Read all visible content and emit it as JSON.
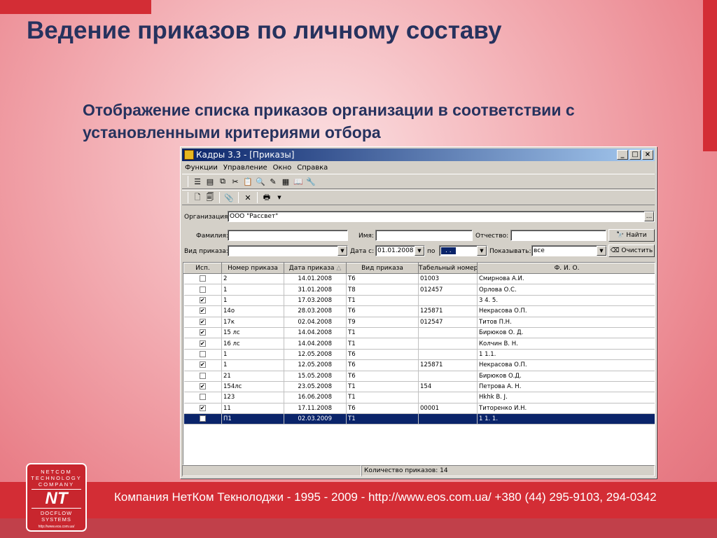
{
  "slide": {
    "title": "Ведение приказов по личному составу",
    "subtitle": "Отображение списка приказов организации в соответствии с установленными критериями отбора"
  },
  "footer": {
    "text": "Компания НетКом Текнолоджи - 1995 - 2009 - http://www.eos.com.ua/ +380 (44) 295-9103, 294-0342"
  },
  "logo": {
    "top": "NETCOM TECHNOLOGY COMPANY",
    "mark": "NT",
    "bottom": "DOCFLOW SYSTEMS",
    "url": "http://www.eos.com.ua/"
  },
  "window": {
    "title": "Кадры 3.3 - [Приказы]",
    "controls": [
      "_",
      "□",
      "×"
    ]
  },
  "menu": [
    "Функции",
    "Управление",
    "Окно",
    "Справка"
  ],
  "filters": {
    "org_label": "Организация:",
    "org_value": "ООО \"Рассвет\"",
    "org_button": "...",
    "surname_label": "Фамилия:",
    "surname_value": "",
    "name_label": "Имя:",
    "name_value": "",
    "patronymic_label": "Отчество:",
    "patronymic_value": "",
    "find_button": "Найти",
    "order_type_label": "Вид приказа:",
    "order_type_value": "",
    "date_from_label": "Дата с:",
    "date_from_value": "01.01.2008",
    "date_to_label": "по",
    "date_to_value": ". .",
    "show_label": "Показывать:",
    "show_value": "все",
    "clear_button": "Очистить"
  },
  "table": {
    "headers": [
      "Исп.",
      "Номер приказа",
      "Дата приказа",
      "Вид приказа",
      "Табельный номер",
      "Ф. И. О."
    ],
    "sort_indicator": "△",
    "rows": [
      {
        "done": false,
        "number": "2",
        "date": "14.01.2008",
        "type": "Т6",
        "tab": "01003",
        "fio": "Смирнова А.И."
      },
      {
        "done": false,
        "number": "1",
        "date": "31.01.2008",
        "type": "Т8",
        "tab": "012457",
        "fio": "Орлова О.С."
      },
      {
        "done": true,
        "number": "1",
        "date": "17.03.2008",
        "type": "Т1",
        "tab": "",
        "fio": "3 4. 5."
      },
      {
        "done": true,
        "number": "14о",
        "date": "28.03.2008",
        "type": "Т6",
        "tab": "125871",
        "fio": "Некрасова О.П."
      },
      {
        "done": true,
        "number": "17к",
        "date": "02.04.2008",
        "type": "Т9",
        "tab": "012547",
        "fio": "Титов П.Н."
      },
      {
        "done": true,
        "number": "15 лс",
        "date": "14.04.2008",
        "type": "Т1",
        "tab": "",
        "fio": "Бирюков О. Д."
      },
      {
        "done": true,
        "number": "16 лс",
        "date": "14.04.2008",
        "type": "Т1",
        "tab": "",
        "fio": "Колчин В. Н."
      },
      {
        "done": false,
        "number": "1",
        "date": "12.05.2008",
        "type": "Т6",
        "tab": "",
        "fio": "1 1.1."
      },
      {
        "done": true,
        "number": "1",
        "date": "12.05.2008",
        "type": "Т6",
        "tab": "125871",
        "fio": "Некрасова О.П."
      },
      {
        "done": false,
        "number": "21",
        "date": "15.05.2008",
        "type": "Т6",
        "tab": "",
        "fio": "Бирюков О.Д."
      },
      {
        "done": true,
        "number": "154лс",
        "date": "23.05.2008",
        "type": "Т1",
        "tab": "154",
        "fio": "Петрова А. Н."
      },
      {
        "done": false,
        "number": "123",
        "date": "16.06.2008",
        "type": "Т1",
        "tab": "",
        "fio": "Hkhk В. J."
      },
      {
        "done": true,
        "number": "11",
        "date": "17.11.2008",
        "type": "Т6",
        "tab": "00001",
        "fio": "Титоренко И.Н."
      },
      {
        "done": false,
        "number": "П1",
        "date": "02.03.2009",
        "type": "Т1",
        "tab": "",
        "fio": "1 1. 1.",
        "selected": true
      }
    ]
  },
  "status": {
    "count_text": "Количество приказов: 14"
  },
  "colors": {
    "accent_red": "#d32d35",
    "title_blue": "#26325e",
    "titlebar": "#0a246a",
    "selection": "#0a246a"
  },
  "toolbar1_icons": [
    "list-icon",
    "card-icon",
    "copy-icon",
    "scissors-icon",
    "clipboard-icon",
    "search-icon",
    "edit-icon",
    "table-icon",
    "book-icon",
    "tools-icon"
  ],
  "toolbar2_icons": [
    "new-doc-icon",
    "open-doc-icon",
    "attach-icon",
    "delete-icon",
    "print-icon"
  ]
}
